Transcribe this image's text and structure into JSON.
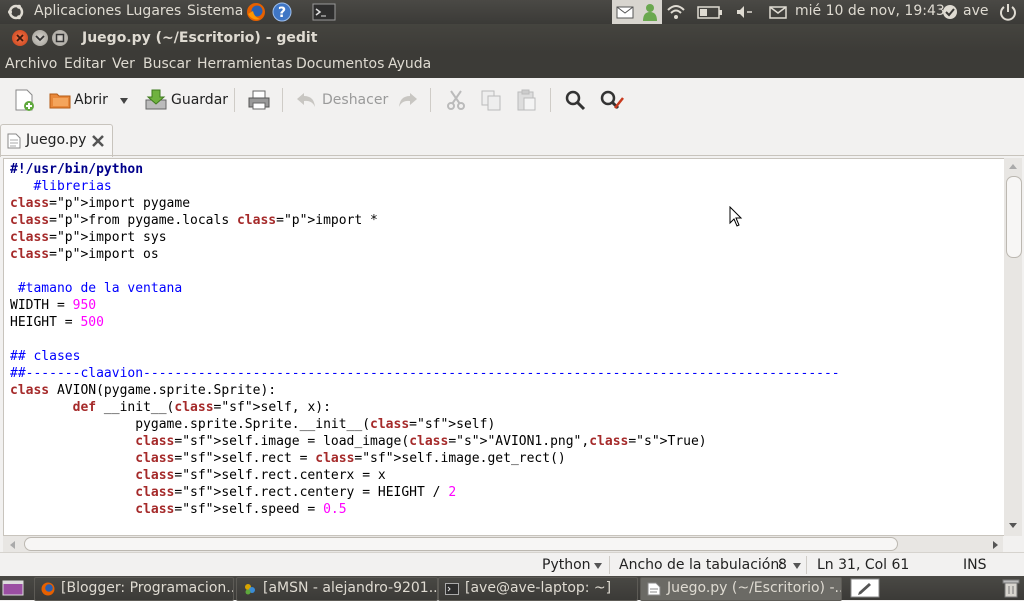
{
  "top_panel": {
    "menus": [
      "Aplicaciones",
      "Lugares",
      "Sistema"
    ],
    "clock": "mié 10 de nov, 19:43",
    "user": "ave"
  },
  "window": {
    "title": "Juego.py (~/Escritorio) - gedit"
  },
  "menubar": [
    "Archivo",
    "Editar",
    "Ver",
    "Buscar",
    "Herramientas",
    "Documentos",
    "Ayuda"
  ],
  "toolbar": {
    "open_label": "Abrir",
    "save_label": "Guardar",
    "undo_label": "Deshacer"
  },
  "tabs": [
    {
      "label": "Juego.py"
    }
  ],
  "code_lines": [
    "#!/usr/bin/python",
    "   #librerias",
    "import pygame",
    "from pygame.locals import *",
    "import sys",
    "import os",
    "",
    " #tamano de la ventana",
    "WIDTH = 950",
    "HEIGHT = 500",
    "",
    "## clases",
    "##-------claavion-----------------------------------------------------------------------------------------",
    "class AVION(pygame.sprite.Sprite):",
    "        def __init__(self, x):",
    "                pygame.sprite.Sprite.__init__(self)",
    "                self.image = load_image(\"AVION1.png\",True)",
    "                self.rect = self.image.get_rect()",
    "                self.rect.centerx = x",
    "                self.rect.centery = HEIGHT / 2",
    "                self.speed = 0.5"
  ],
  "statusbar": {
    "language": "Python",
    "tab_width_label": "Ancho de la tabulación:",
    "tab_width_value": "8",
    "position": "Ln 31, Col 61",
    "mode": "INS"
  },
  "taskbar": [
    {
      "label": "[Blogger: Programacion...",
      "icon": "firefox-icon",
      "active": false
    },
    {
      "label": "[aMSN - alejandro-9201...",
      "icon": "amsn-icon",
      "active": false
    },
    {
      "label": "[ave@ave-laptop: ~]",
      "icon": "terminal-icon",
      "active": false
    },
    {
      "label": "Juego.py (~/Escritorio) -...",
      "icon": "gedit-icon",
      "active": true
    }
  ]
}
